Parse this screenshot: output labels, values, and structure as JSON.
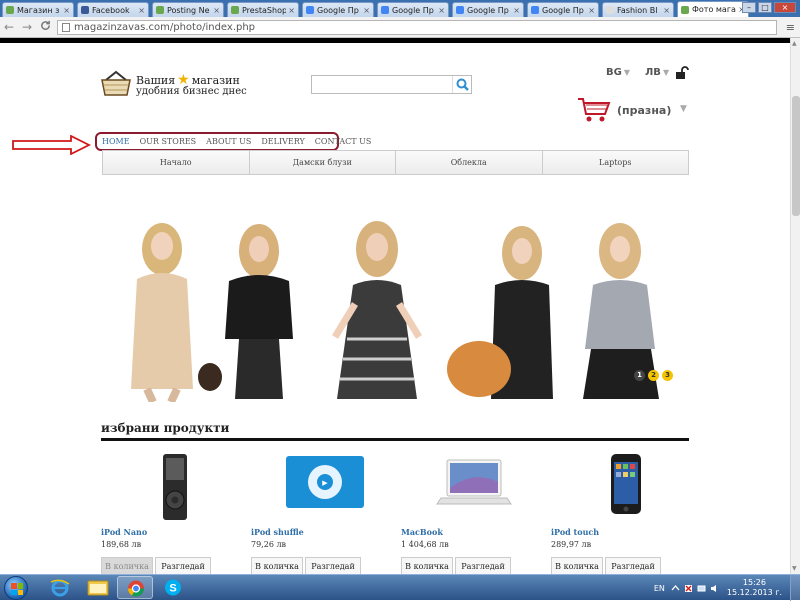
{
  "browser": {
    "tabs": [
      {
        "label": "Магазин з",
        "favicon_color": "#6aa84f",
        "active": false
      },
      {
        "label": "Facebook",
        "favicon_color": "#3b5998",
        "active": false
      },
      {
        "label": "Posting Ne",
        "favicon_color": "#6aa84f",
        "active": false
      },
      {
        "label": "PrestaShop",
        "favicon_color": "#6aa84f",
        "active": false
      },
      {
        "label": "Google Пр",
        "favicon_color": "#4285f4",
        "active": false
      },
      {
        "label": "Google Пр",
        "favicon_color": "#4285f4",
        "active": false
      },
      {
        "label": "Google Пр",
        "favicon_color": "#4285f4",
        "active": false
      },
      {
        "label": "Google Пр",
        "favicon_color": "#4285f4",
        "active": false
      },
      {
        "label": "Fashion Bl",
        "favicon_color": "#dddddd",
        "active": false
      },
      {
        "label": "Фото магаз",
        "favicon_color": "#6aa84f",
        "active": true
      }
    ],
    "tab_close": "×",
    "back": "←",
    "forward": "→",
    "reload": "C",
    "url": "magazinzavas.com/photo/index.php",
    "menu": "≡",
    "window_controls": {
      "minimize": "–",
      "maximize": "□",
      "close": "×"
    }
  },
  "shop": {
    "logo_line1_a": "Вашия",
    "logo_line1_b": "магазин",
    "logo_line2": "удобния бизнес днес",
    "search_placeholder": "",
    "language": "BG",
    "currency": "ЛВ",
    "caret": "▼",
    "cart_status": "(празна)",
    "top_menu": [
      "HOME",
      "OUR STORES",
      "ABOUT US",
      "DELIVERY",
      "CONTACT US"
    ],
    "categories": [
      "Начало",
      "Дамски блузи",
      "Облекла",
      "Laptops"
    ],
    "slider_dots": [
      "1",
      "2",
      "3"
    ],
    "featured_title": "избрани продукти",
    "products": [
      {
        "name": "iPod Nano",
        "price": "189,68 лв",
        "add": "В количка",
        "view": "Разгледай",
        "add_disabled": true,
        "icon": "ipod-nano-icon"
      },
      {
        "name": "iPod shuffle",
        "price": "79,26 лв",
        "add": "В количка",
        "view": "Разгледай",
        "add_disabled": false,
        "icon": "ipod-shuffle-icon"
      },
      {
        "name": "MacBook",
        "price": "1 404,68 лв",
        "add": "В количка",
        "view": "Разгледай",
        "add_disabled": false,
        "icon": "macbook-icon"
      },
      {
        "name": "iPod touch",
        "price": "289,97 лв",
        "add": "В количка",
        "view": "Разгледай",
        "add_disabled": false,
        "icon": "ipod-touch-icon"
      }
    ]
  },
  "taskbar": {
    "language": "EN",
    "time": "15:26",
    "date": "15.12.2013 г."
  },
  "colors": {
    "menu_border": "#8b1b2f",
    "link_blue": "#2f6ea6",
    "arrow_red": "#d01818",
    "taskbar": "#2b5387"
  }
}
